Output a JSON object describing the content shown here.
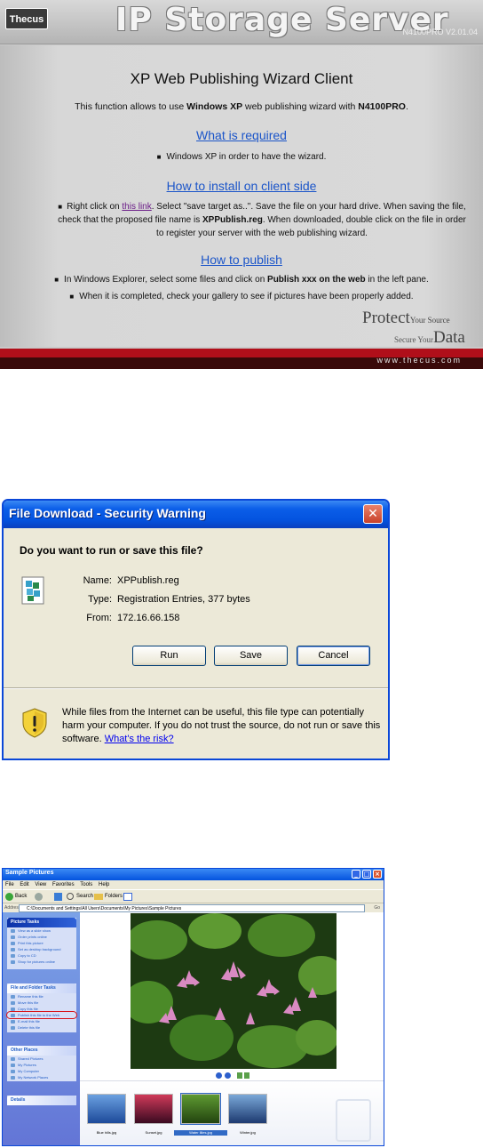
{
  "thecus_page": {
    "logo": "Thecus",
    "product_title": "IP Storage Server",
    "version": "N4100PRO V2.01.04",
    "heading": "XP Web Publishing Wizard Client",
    "intro_prefix": "This function allows to use ",
    "intro_bold1": "Windows XP",
    "intro_mid": " web publishing wizard with ",
    "intro_bold2": "N4100PRO",
    "intro_suffix": ".",
    "section1_title": "What is required",
    "section1_bullet": "Windows XP in order to have the wizard.",
    "section2_title": "How to install on client side",
    "section2_pre": "Right click on ",
    "section2_link": "this link",
    "section2_text": ". Select \"save target as..\". Save the file on your hard drive. When saving the file, check that the proposed file name is ",
    "section2_file": "XPPublish.reg",
    "section2_end": ". When downloaded, double click on the file in order to register your server with the web publishing wizard.",
    "section3_title": "How to publish",
    "section3_bullet1_pre": "In Windows Explorer, select some files and click on ",
    "section3_bullet1_bold": "Publish xxx on the web",
    "section3_bullet1_post": " in the left pane.",
    "section3_bullet2": "When it is completed, check your gallery to see if pictures have been properly added.",
    "tagline_protect": "Protect",
    "tagline_your_source": "Your Source",
    "tagline_secure_your": "Secure Your",
    "tagline_data": "Data",
    "footer_url": "www.thecus.com"
  },
  "file_download": {
    "title": "File Download - Security Warning",
    "close_glyph": "✕",
    "question": "Do you want to run or save this file?",
    "name_label": "Name:",
    "name_value": "XPPublish.reg",
    "type_label": "Type:",
    "type_value": "Registration Entries, 377 bytes",
    "from_label": "From:",
    "from_value": "172.16.66.158",
    "run_button": "Run",
    "save_button": "Save",
    "cancel_button": "Cancel",
    "warning_text": "While files from the Internet can be useful, this file type can potentially harm your computer. If you do not trust the source, do not run or save this software. ",
    "warning_link": "What's the risk?"
  },
  "explorer": {
    "title": "Sample Pictures",
    "menu": [
      "File",
      "Edit",
      "View",
      "Favorites",
      "Tools",
      "Help"
    ],
    "toolbar": {
      "back": "Back",
      "search": "Search",
      "folders": "Folders"
    },
    "address_label": "Address",
    "address_value": "C:\\Documents and Settings\\All Users\\Documents\\My Pictures\\Sample Pictures",
    "go_label": "Go",
    "picture_tasks_title": "Picture Tasks",
    "picture_tasks": [
      "View as a slide show",
      "Order prints online",
      "Print this picture",
      "Set as desktop background",
      "Copy to CD",
      "Shop for pictures online"
    ],
    "file_tasks_title": "File and Folder Tasks",
    "file_tasks": [
      "Rename this file",
      "Move this file",
      "Copy this file",
      "Publish this file to the Web",
      "E-mail this file",
      "Delete this file"
    ],
    "highlighted_task": "Publish this file to the Web",
    "other_places_title": "Other Places",
    "other_places": [
      "Shared Pictures",
      "My Pictures",
      "My Computer",
      "My Network Places"
    ],
    "details_title": "Details",
    "thumbnails": [
      {
        "caption": "Blue hills.jpg",
        "selected": false,
        "color": "#2a5ca8"
      },
      {
        "caption": "Sunset.jpg",
        "selected": false,
        "color": "#b01a3a"
      },
      {
        "caption": "Water lilies.jpg",
        "selected": true,
        "color": "#3b6a20"
      },
      {
        "caption": "Winter.jpg",
        "selected": false,
        "color": "#23467e"
      }
    ]
  },
  "colors": {
    "xp_blue": "#0453df",
    "dialog_bg": "#ece9d8",
    "thecus_red": "#b00f1a",
    "link_blue": "#1b55c9"
  }
}
